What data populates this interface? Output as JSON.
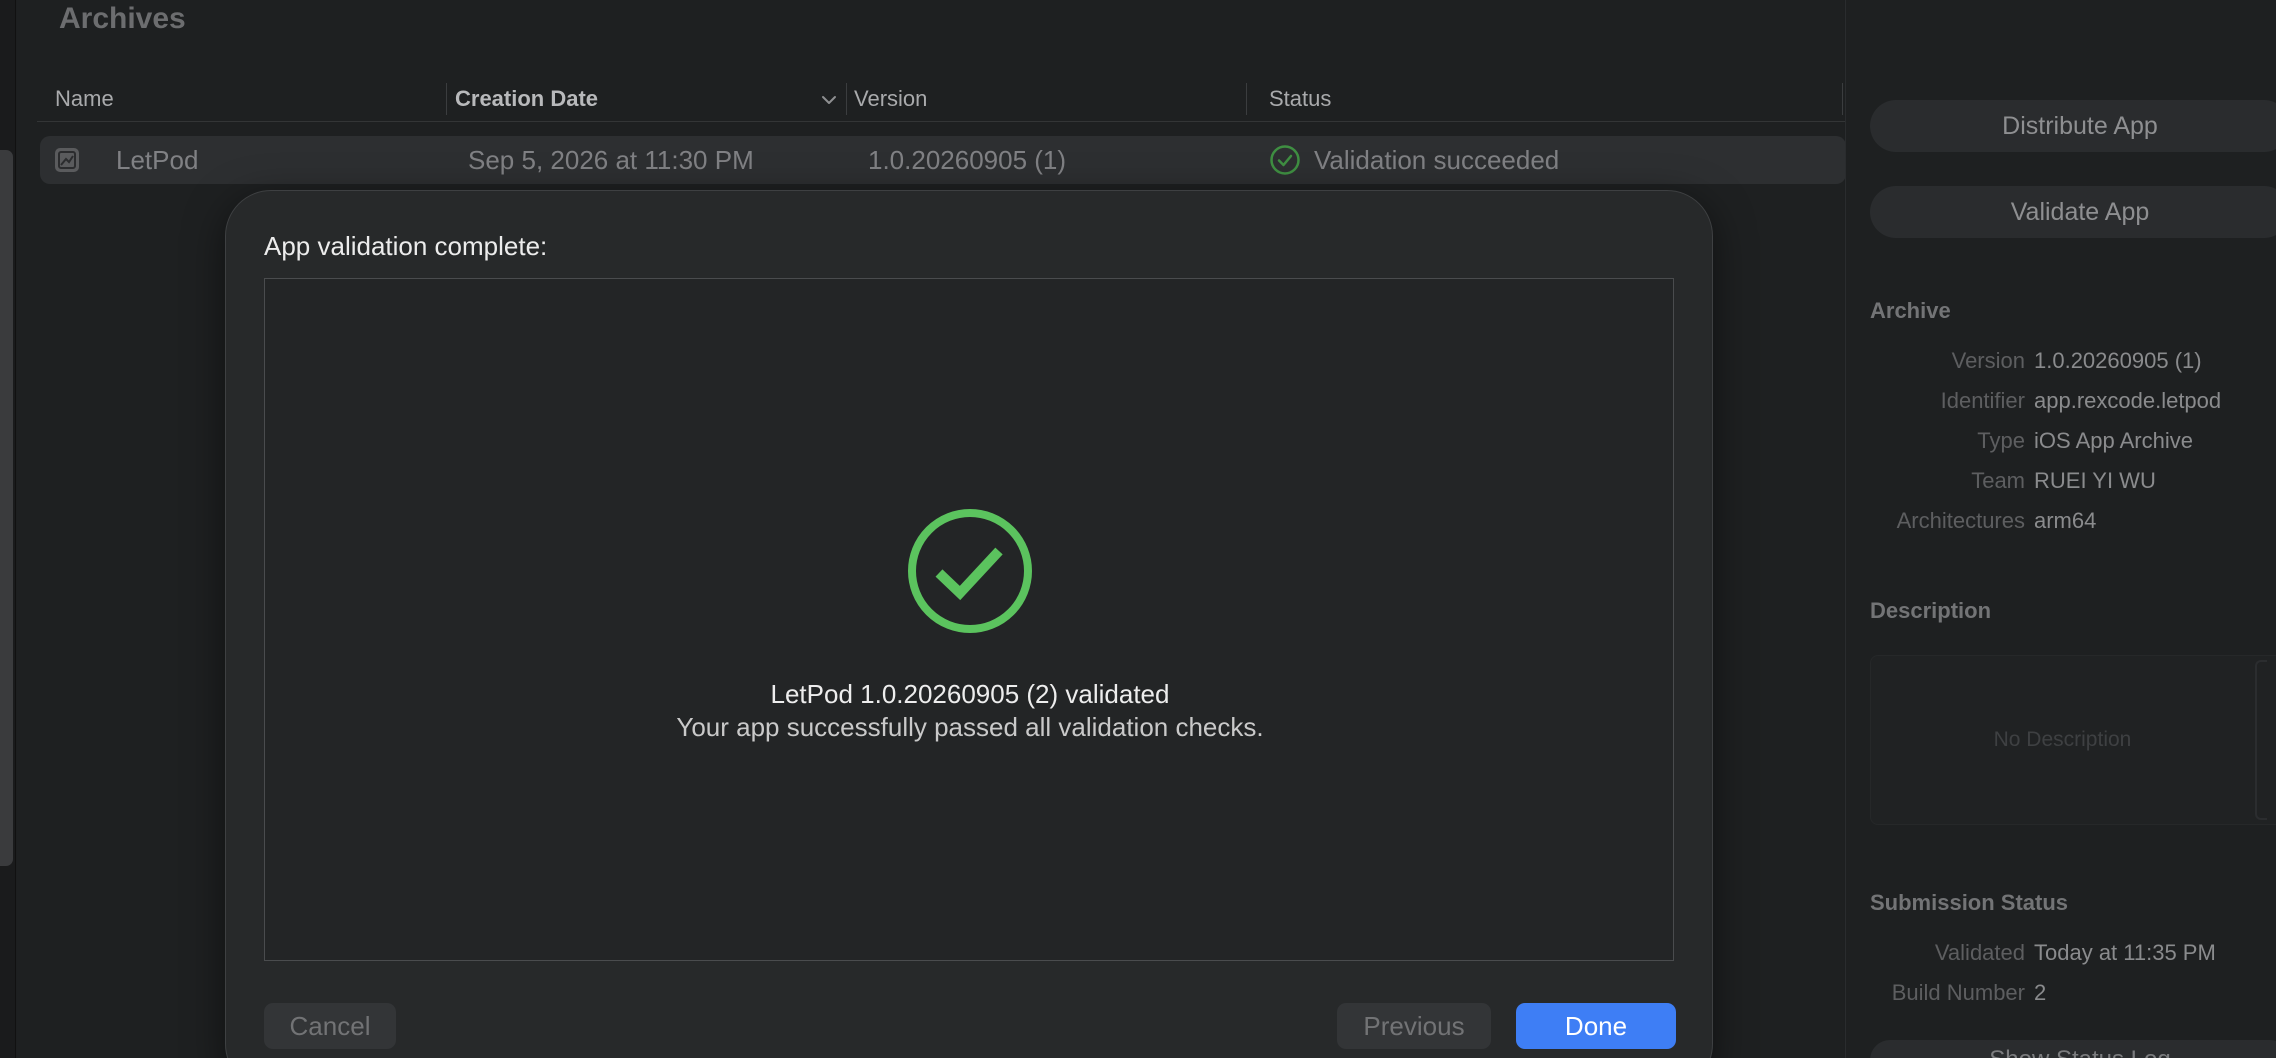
{
  "archives": {
    "title": "Archives",
    "columns": [
      "Name",
      "Creation Date",
      "Version",
      "Status"
    ],
    "rows": [
      {
        "name": "LetPod",
        "creation_date": "Sep 5, 2026 at 11:30 PM",
        "version": "1.0.20260905 (1)",
        "status": "Validation succeeded"
      }
    ]
  },
  "inspector": {
    "buttons": {
      "distribute": "Distribute App",
      "validate": "Validate App",
      "partial": "Show Status Log"
    },
    "archive_section": {
      "title": "Archive",
      "fields": [
        {
          "label": "Version",
          "value": "1.0.20260905 (1)"
        },
        {
          "label": "Identifier",
          "value": "app.rexcode.letpod"
        },
        {
          "label": "Type",
          "value": "iOS App Archive"
        },
        {
          "label": "Team",
          "value": "RUEI YI WU"
        },
        {
          "label": "Architectures",
          "value": "arm64"
        }
      ]
    },
    "description_section": {
      "title": "Description",
      "placeholder": "No Description"
    },
    "submission_section": {
      "title": "Submission Status",
      "fields": [
        {
          "label": "Validated",
          "value": "Today at 11:35 PM"
        },
        {
          "label": "Build Number",
          "value": "2"
        }
      ]
    }
  },
  "sheet": {
    "title": "App validation complete:",
    "result_title": "LetPod 1.0.20260905 (2) validated",
    "result_subtitle": "Your app successfully passed all validation checks.",
    "cancel_label": "Cancel",
    "previous_label": "Previous",
    "done_label": "Done"
  },
  "colors": {
    "success_green": "#5bc35e",
    "accent_blue": "#3e7ef5"
  },
  "icons": {
    "success": "checkmark-circle-icon",
    "row_status": "checkmark-circle-icon",
    "row_app": "archive-app-icon",
    "sort": "chevron-down-icon"
  }
}
